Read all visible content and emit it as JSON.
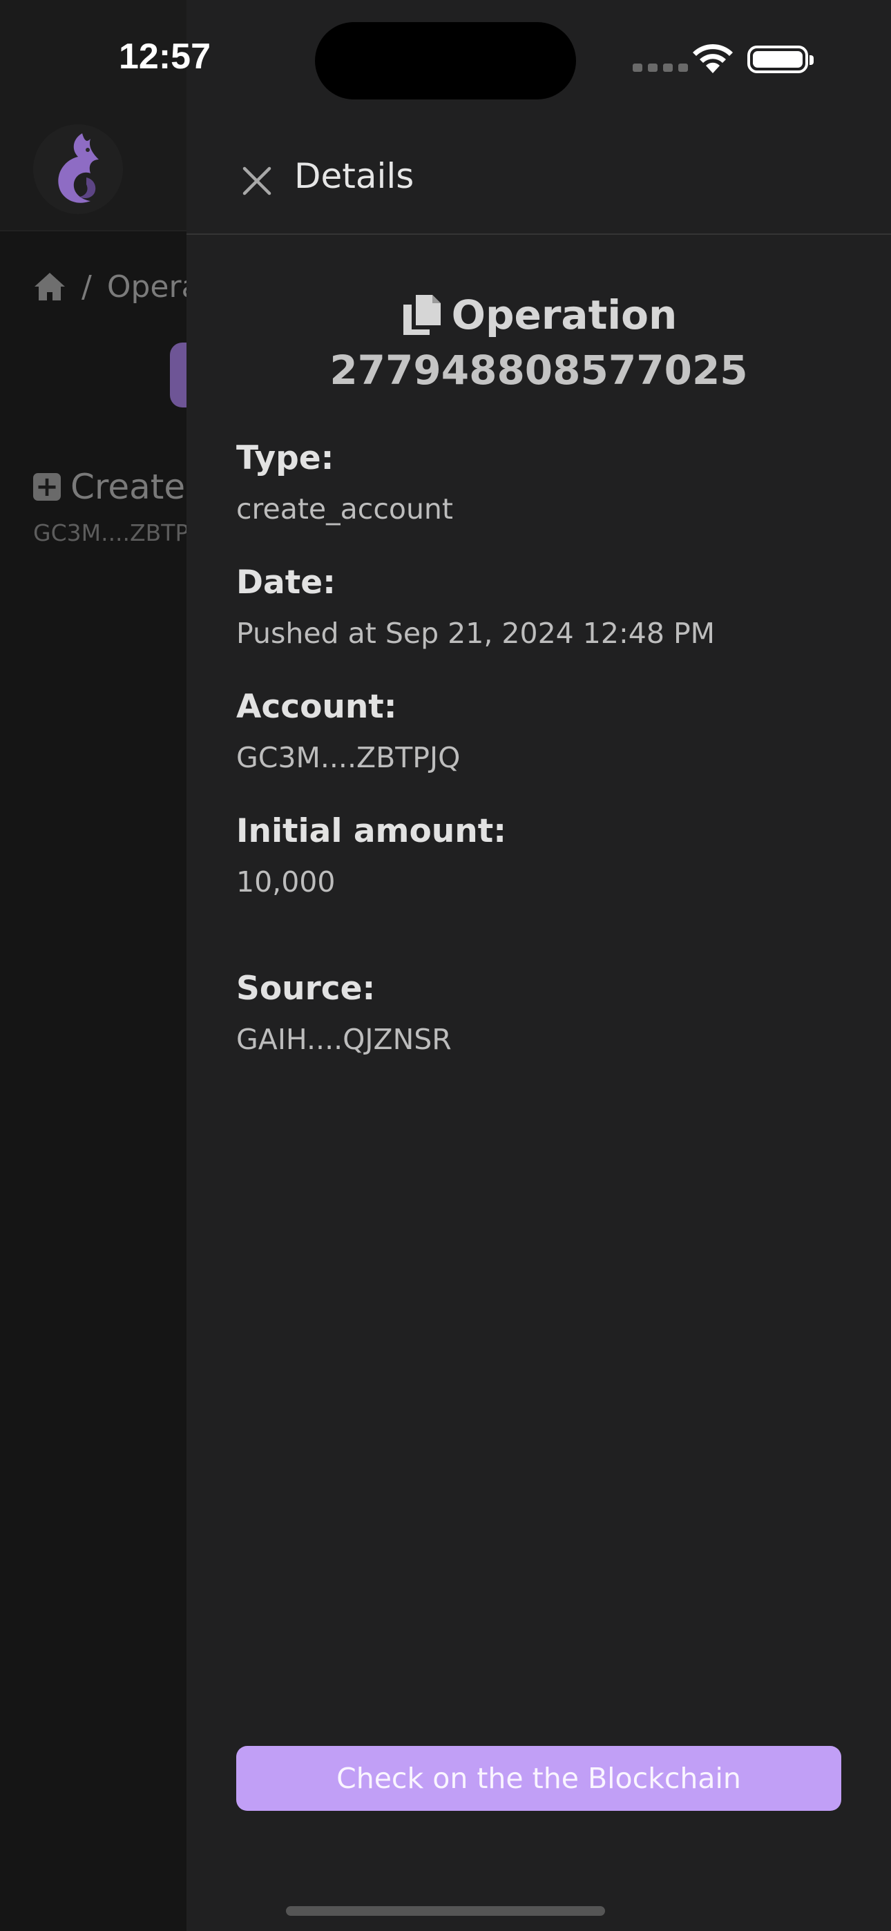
{
  "status_bar": {
    "time": "12:57"
  },
  "background": {
    "breadcrumb_separator": "/",
    "breadcrumb_current": "Opera",
    "operation_title": "Create",
    "operation_account": "GC3M....ZBTP"
  },
  "drawer": {
    "title": "Details",
    "heading": "Operation",
    "operation_id": "277948808577025",
    "fields": [
      {
        "label": "Type:",
        "value": "create_account"
      },
      {
        "label": "Date:",
        "value": "Pushed at Sep 21, 2024 12:48 PM"
      },
      {
        "label": "Account:",
        "value": "GC3M....ZBTPJQ"
      },
      {
        "label": "Initial amount:",
        "value": "10,000"
      },
      {
        "label": "Source:",
        "value": "GAIH....QJZNSR"
      }
    ],
    "button_label": "Check on the the Blockchain"
  },
  "icons": {
    "close": "close-icon",
    "copy": "copy-icon",
    "home": "home-icon",
    "logo": "dragon-logo",
    "wifi": "wifi-icon",
    "battery": "battery-icon"
  },
  "colors": {
    "accent_button": "#c19ff6",
    "drawer_bg": "#202021",
    "logo_purple": "#8e6cc4"
  }
}
